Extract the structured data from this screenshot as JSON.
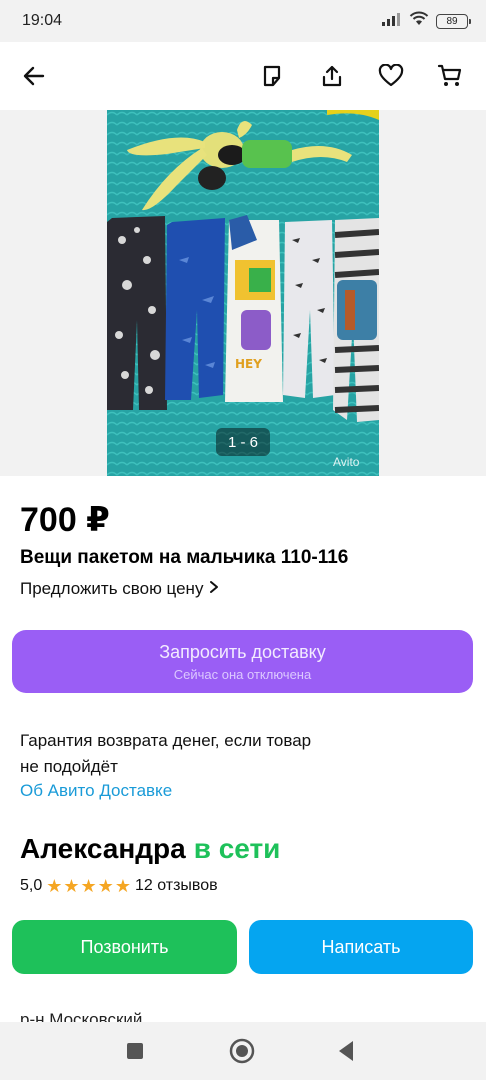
{
  "status_bar": {
    "time": "19:04",
    "battery": "89"
  },
  "app_bar": {
    "icons": [
      "back-arrow-icon",
      "note-icon",
      "share-icon",
      "heart-icon",
      "cart-icon"
    ]
  },
  "gallery": {
    "counter": "1 - 6",
    "watermark": "Avito"
  },
  "listing": {
    "price": "700 ₽",
    "title": "Вещи пакетом на мальчика 110-116",
    "offer_link": "Предложить свою цену"
  },
  "delivery": {
    "button_label": "Запросить доставку",
    "button_sublabel": "Сейчас она отключена"
  },
  "guarantee": {
    "line1": "Гарантия возврата денег, если товар",
    "line2": "не подойдёт",
    "link": "Об Авито Доставке"
  },
  "seller": {
    "name": "Александра",
    "status": "в сети",
    "rating": "5,0",
    "stars": 5,
    "reviews": "12 отзывов"
  },
  "actions": {
    "call_label": "Позвонить",
    "write_label": "Написать"
  },
  "address": "р-н Московский",
  "colors": {
    "delivery_button": "#9a5ef5",
    "call_button": "#1ec15a",
    "write_button": "#05a5f0",
    "link": "#1a9bd8",
    "online": "#1ec15a",
    "star": "#f5a623"
  }
}
